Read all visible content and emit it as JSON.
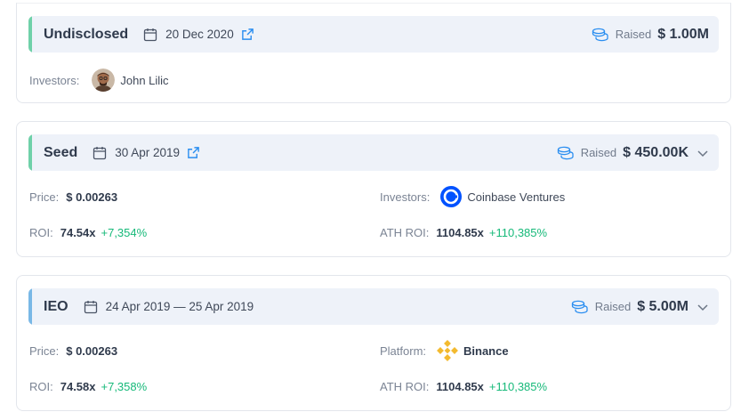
{
  "rounds": [
    {
      "name": "Undisclosed",
      "date": "20 Dec 2020",
      "raised_label": "Raised",
      "raised_value": "$ 1.00M",
      "accent": "#6fd1a9",
      "investors_label": "Investors:",
      "investor": "John Lilic"
    },
    {
      "name": "Seed",
      "date": "30 Apr 2019",
      "raised_label": "Raised",
      "raised_value": "$ 450.00K",
      "accent": "#6fd1a9",
      "price_label": "Price:",
      "price": "$ 0.00263",
      "roi_label": "ROI:",
      "roi": "74.54x",
      "roi_pct": "+7,354%",
      "investors_label": "Investors:",
      "investor": "Coinbase Ventures",
      "ath_roi_label": "ATH ROI:",
      "ath_roi": "1104.85x",
      "ath_roi_pct": "+110,385%"
    },
    {
      "name": "IEO",
      "date": "24 Apr 2019 — 25 Apr 2019",
      "raised_label": "Raised",
      "raised_value": "$ 5.00M",
      "accent": "#79b8e6",
      "price_label": "Price:",
      "price": "$ 0.00263",
      "roi_label": "ROI:",
      "roi": "74.58x",
      "roi_pct": "+7,358%",
      "platform_label": "Platform:",
      "platform": "Binance",
      "ath_roi_label": "ATH ROI:",
      "ath_roi": "1104.85x",
      "ath_roi_pct": "+110,385%"
    }
  ],
  "icons": {
    "calendar": "calendar-icon",
    "external": "external-link-icon",
    "coins": "coins-icon",
    "chevron": "chevron-down-icon"
  },
  "colors": {
    "link_blue": "#2b8ef0",
    "positive_green": "#16b979",
    "coinbase_blue": "#0052ff",
    "binance_yellow": "#f3ba2f"
  }
}
